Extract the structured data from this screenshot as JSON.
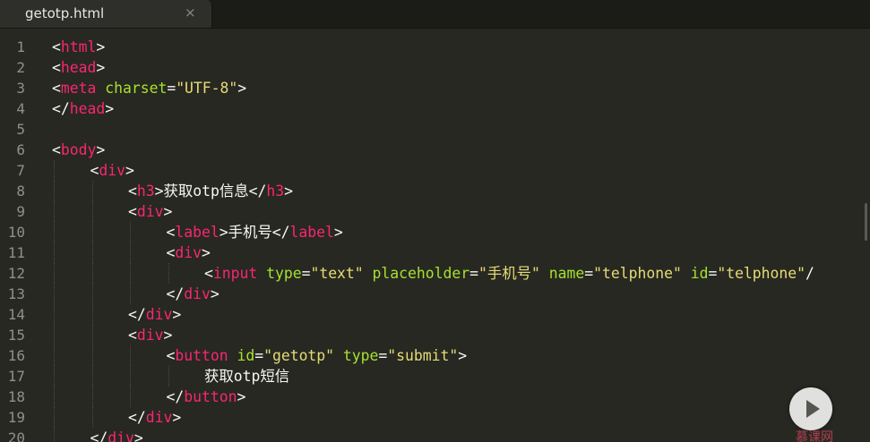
{
  "tab": {
    "title": "getotp.html",
    "close_glyph": "×"
  },
  "colors": {
    "background": "#272822",
    "tag": "#f92672",
    "attribute": "#a6e22e",
    "string": "#e6db74",
    "text": "#f8f8f2",
    "line_number": "#8f908a"
  },
  "lines": [
    {
      "num": "1",
      "indent": 0,
      "tokens": [
        [
          "p",
          "<"
        ],
        [
          "tag",
          "html"
        ],
        [
          "p",
          ">"
        ]
      ]
    },
    {
      "num": "2",
      "indent": 0,
      "tokens": [
        [
          "p",
          "<"
        ],
        [
          "tag",
          "head"
        ],
        [
          "p",
          ">"
        ]
      ]
    },
    {
      "num": "3",
      "indent": 0,
      "tokens": [
        [
          "p",
          "<"
        ],
        [
          "tag",
          "meta"
        ],
        [
          "p",
          " "
        ],
        [
          "attr",
          "charset"
        ],
        [
          "p",
          "="
        ],
        [
          "str",
          "\"UTF-8\""
        ],
        [
          "p",
          ">"
        ]
      ]
    },
    {
      "num": "4",
      "indent": 0,
      "tokens": [
        [
          "p",
          "</"
        ],
        [
          "tag",
          "head"
        ],
        [
          "p",
          ">"
        ]
      ]
    },
    {
      "num": "5",
      "indent": 0,
      "tokens": []
    },
    {
      "num": "6",
      "indent": 0,
      "tokens": [
        [
          "p",
          "<"
        ],
        [
          "tag",
          "body"
        ],
        [
          "p",
          ">"
        ]
      ]
    },
    {
      "num": "7",
      "indent": 1,
      "tokens": [
        [
          "p",
          "<"
        ],
        [
          "tag",
          "div"
        ],
        [
          "p",
          ">"
        ]
      ]
    },
    {
      "num": "8",
      "indent": 2,
      "tokens": [
        [
          "p",
          "<"
        ],
        [
          "tag",
          "h3"
        ],
        [
          "p",
          ">"
        ],
        [
          "text",
          "获取otp信息"
        ],
        [
          "p",
          "</"
        ],
        [
          "tag",
          "h3"
        ],
        [
          "p",
          ">"
        ]
      ]
    },
    {
      "num": "9",
      "indent": 2,
      "tokens": [
        [
          "p",
          "<"
        ],
        [
          "tag",
          "div"
        ],
        [
          "p",
          ">"
        ]
      ]
    },
    {
      "num": "10",
      "indent": 3,
      "tokens": [
        [
          "p",
          "<"
        ],
        [
          "tag",
          "label"
        ],
        [
          "p",
          ">"
        ],
        [
          "text",
          "手机号"
        ],
        [
          "p",
          "</"
        ],
        [
          "tag",
          "label"
        ],
        [
          "p",
          ">"
        ]
      ]
    },
    {
      "num": "11",
      "indent": 3,
      "tokens": [
        [
          "p",
          "<"
        ],
        [
          "tag",
          "div"
        ],
        [
          "p",
          ">"
        ]
      ]
    },
    {
      "num": "12",
      "indent": 4,
      "tokens": [
        [
          "p",
          "<"
        ],
        [
          "tag",
          "input"
        ],
        [
          "p",
          " "
        ],
        [
          "attr",
          "type"
        ],
        [
          "p",
          "="
        ],
        [
          "str",
          "\"text\""
        ],
        [
          "p",
          " "
        ],
        [
          "attr",
          "placeholder"
        ],
        [
          "p",
          "="
        ],
        [
          "str",
          "\"手机号\""
        ],
        [
          "p",
          " "
        ],
        [
          "attr",
          "name"
        ],
        [
          "p",
          "="
        ],
        [
          "str",
          "\"telphone\""
        ],
        [
          "p",
          " "
        ],
        [
          "attr",
          "id"
        ],
        [
          "p",
          "="
        ],
        [
          "str",
          "\"telphone\""
        ],
        [
          "p",
          "/"
        ]
      ]
    },
    {
      "num": "13",
      "indent": 3,
      "tokens": [
        [
          "p",
          "</"
        ],
        [
          "tag",
          "div"
        ],
        [
          "p",
          ">"
        ]
      ]
    },
    {
      "num": "14",
      "indent": 2,
      "tokens": [
        [
          "p",
          "</"
        ],
        [
          "tag",
          "div"
        ],
        [
          "p",
          ">"
        ]
      ]
    },
    {
      "num": "15",
      "indent": 2,
      "tokens": [
        [
          "p",
          "<"
        ],
        [
          "tag",
          "div"
        ],
        [
          "p",
          ">"
        ]
      ]
    },
    {
      "num": "16",
      "indent": 3,
      "tokens": [
        [
          "p",
          "<"
        ],
        [
          "tag",
          "button"
        ],
        [
          "p",
          " "
        ],
        [
          "attr",
          "id"
        ],
        [
          "p",
          "="
        ],
        [
          "str",
          "\"getotp\""
        ],
        [
          "p",
          " "
        ],
        [
          "attr",
          "type"
        ],
        [
          "p",
          "="
        ],
        [
          "str",
          "\"submit\""
        ],
        [
          "p",
          ">"
        ]
      ]
    },
    {
      "num": "17",
      "indent": 4,
      "tokens": [
        [
          "text",
          "获取otp短信"
        ]
      ]
    },
    {
      "num": "18",
      "indent": 3,
      "tokens": [
        [
          "p",
          "</"
        ],
        [
          "tag",
          "button"
        ],
        [
          "p",
          ">"
        ]
      ]
    },
    {
      "num": "19",
      "indent": 2,
      "tokens": [
        [
          "p",
          "</"
        ],
        [
          "tag",
          "div"
        ],
        [
          "p",
          ">"
        ]
      ]
    },
    {
      "num": "20",
      "indent": 1,
      "tokens": [
        [
          "p",
          "</"
        ],
        [
          "tag",
          "div"
        ],
        [
          "p",
          ">"
        ]
      ]
    }
  ],
  "overlay": {
    "play_icon": "play-icon",
    "watermark": "慕课网"
  }
}
